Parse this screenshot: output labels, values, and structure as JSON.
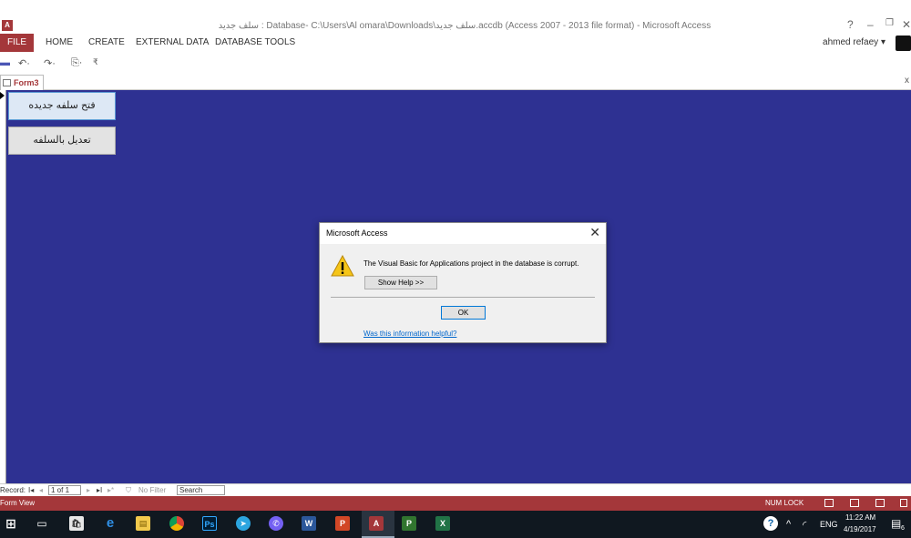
{
  "window": {
    "app_logo": "A",
    "title": "سلف جديد : Database- C:\\Users\\Al omara\\Downloads\\سلف جديد.accdb (Access 2007 - 2013 file format) - Microsoft Access",
    "help_glyph": "?",
    "minimize_glyph": "–",
    "restore_glyph": "❐",
    "close_glyph": "✕"
  },
  "ribbon": {
    "tabs": [
      "FILE",
      "HOME",
      "CREATE",
      "EXTERNAL DATA",
      "DATABASE TOOLS"
    ],
    "user": "ahmed refaey",
    "user_chevron": "▾"
  },
  "qat": {
    "save_glyph": "▬",
    "undo_glyph": "↶·",
    "redo_glyph": "↷·",
    "copy_glyph": "⎘·",
    "more_glyph": "₹"
  },
  "doc_tab": {
    "label": "Form3",
    "close_glyph": "x"
  },
  "form": {
    "button1": "فتح سلفه جديده",
    "button2": "تعديل بالسلفه",
    "colors": {
      "background": "#2e3192"
    }
  },
  "dialog": {
    "title": "Microsoft Access",
    "close_glyph": "✕",
    "message": "The Visual Basic for Applications project in the database is corrupt.",
    "show_help": "Show Help >>",
    "ok": "OK",
    "link": "Was this information helpful?"
  },
  "record_nav": {
    "label": "Record:",
    "first_glyph": "I◂",
    "prev_glyph": "◂",
    "current": "1 of 1",
    "next_glyph": "▸",
    "last_glyph": "▸I",
    "new_glyph": "▸*",
    "filter_glyph": "⛉",
    "filter": "No Filter",
    "search": "Search"
  },
  "statusbar": {
    "view": "Form View",
    "numlock": "NUM LOCK",
    "color": "#a4373a"
  },
  "taskbar": {
    "icons": [
      "windows-icon",
      "task-view-icon",
      "store-icon",
      "edge-icon",
      "explorer-icon",
      "chrome-icon",
      "photoshop-icon",
      "telegram-icon",
      "viber-icon",
      "word-icon",
      "powerpoint-icon",
      "access-icon",
      "project-icon",
      "excel-icon"
    ],
    "start_glyph": "⊞",
    "task_view_glyph": "▭",
    "store_glyph": "🛍",
    "edge_glyph": "e",
    "explorer_glyph": "▤",
    "photoshop_glyph": "Ps",
    "telegram_glyph": "➤",
    "viber_glyph": "✆",
    "word_glyph": "W",
    "powerpoint_glyph": "P",
    "access_glyph": "A",
    "project_glyph": "P",
    "excel_glyph": "X",
    "help_glyph": "?",
    "caret_glyph": "^",
    "network_glyph": "◜",
    "language": "ENG",
    "time": "11:22 AM",
    "date": "4/19/2017",
    "notification_glyph": "▤",
    "notification_count": "6"
  }
}
